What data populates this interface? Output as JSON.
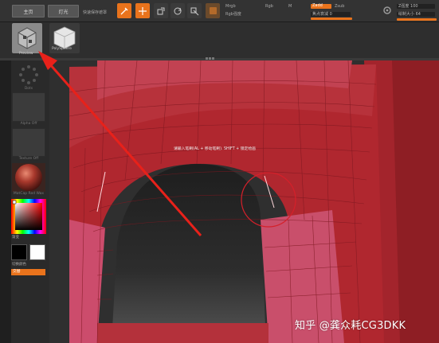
{
  "toolbar": {
    "btn1_label": "主页",
    "btn2_label": "灯光",
    "label_misc": "快速保存遮罩",
    "mrgb_label": "Mrgb",
    "rgb_label": "Rgb",
    "m_label": "M",
    "zadd_label": "Zadd",
    "zsub_label": "Zsub",
    "rgb_strength_label": "Rgb强度",
    "focal_shift_label": "焦点衰减 0",
    "z_strength_label": "Z强度 100",
    "draw_size_label": "绘制大小 64",
    "intensity_label": "强度 100",
    "draw_label": "绘制"
  },
  "row2": {
    "icon1_label": "Preview",
    "icon2_label": "PolySphere"
  },
  "leftpanel": {
    "brush_caption": "Dots",
    "alpha_caption": "Alpha Off",
    "texture_caption": "Texture Off",
    "material_caption": "MatCap Red Wax",
    "gradient_label": "渐变",
    "switch_color_label": "切换颜色",
    "alternate_label": "交替"
  },
  "viewport": {
    "brush_tip": "请输入笔刷(AL + 移动笔刷). SHIFT + 锁定绘画"
  },
  "watermark": "知乎 @龚众耗CG3DKK",
  "colors": {
    "accent": "#e9731c",
    "mesh_red": "#b0272f",
    "mesh_pink": "#c8506a",
    "arrow": "#e8211a"
  },
  "icons": [
    "move-icon",
    "scale-icon",
    "rotate-icon",
    "brush-dots-icon"
  ]
}
